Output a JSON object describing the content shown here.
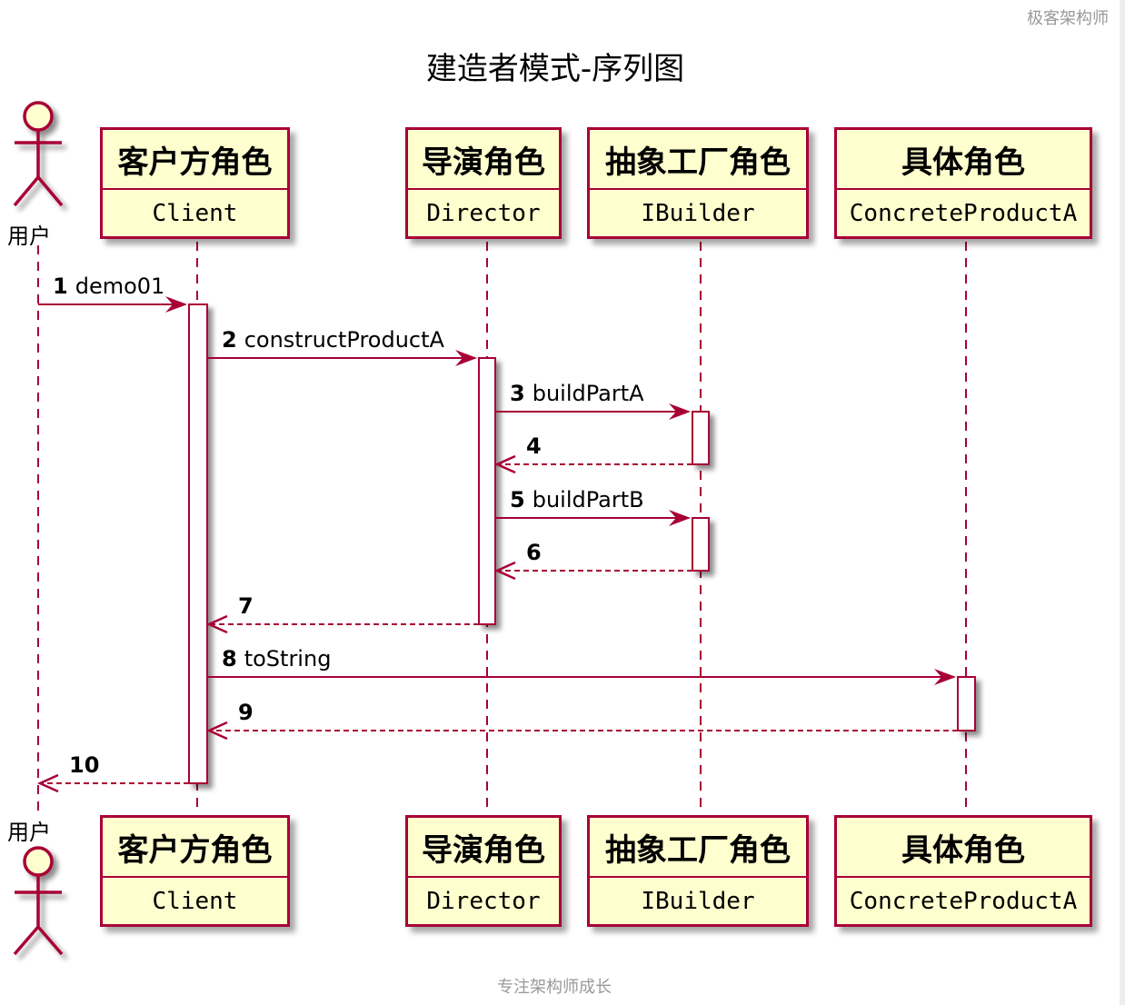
{
  "watermark_top": "极客架构师",
  "title": "建造者模式-序列图",
  "watermark_bottom": "专注架构师成长",
  "colors": {
    "line": "#a80036",
    "participant_fill": "#fefece",
    "watermark": "#999999"
  },
  "actor": {
    "label": "用户",
    "icon": "stick-figure-icon"
  },
  "participants": [
    {
      "id": "client",
      "title": "客户方角色",
      "name": "Client"
    },
    {
      "id": "director",
      "title": "导演角色",
      "name": "Director"
    },
    {
      "id": "builder",
      "title": "抽象工厂角色",
      "name": "IBuilder"
    },
    {
      "id": "product",
      "title": "具体角色",
      "name": "ConcreteProductA"
    }
  ],
  "messages": [
    {
      "num": "1",
      "label": "demo01",
      "from": "user",
      "to": "client",
      "type": "sync"
    },
    {
      "num": "2",
      "label": "constructProductA",
      "from": "client",
      "to": "director",
      "type": "sync"
    },
    {
      "num": "3",
      "label": "buildPartA",
      "from": "director",
      "to": "builder",
      "type": "sync"
    },
    {
      "num": "4",
      "label": "",
      "from": "builder",
      "to": "director",
      "type": "return"
    },
    {
      "num": "5",
      "label": "buildPartB",
      "from": "director",
      "to": "builder",
      "type": "sync"
    },
    {
      "num": "6",
      "label": "",
      "from": "builder",
      "to": "director",
      "type": "return"
    },
    {
      "num": "7",
      "label": "",
      "from": "director",
      "to": "client",
      "type": "return"
    },
    {
      "num": "8",
      "label": "toString",
      "from": "client",
      "to": "product",
      "type": "sync"
    },
    {
      "num": "9",
      "label": "",
      "from": "product",
      "to": "client",
      "type": "return"
    },
    {
      "num": "10",
      "label": "",
      "from": "client",
      "to": "user",
      "type": "return"
    }
  ]
}
